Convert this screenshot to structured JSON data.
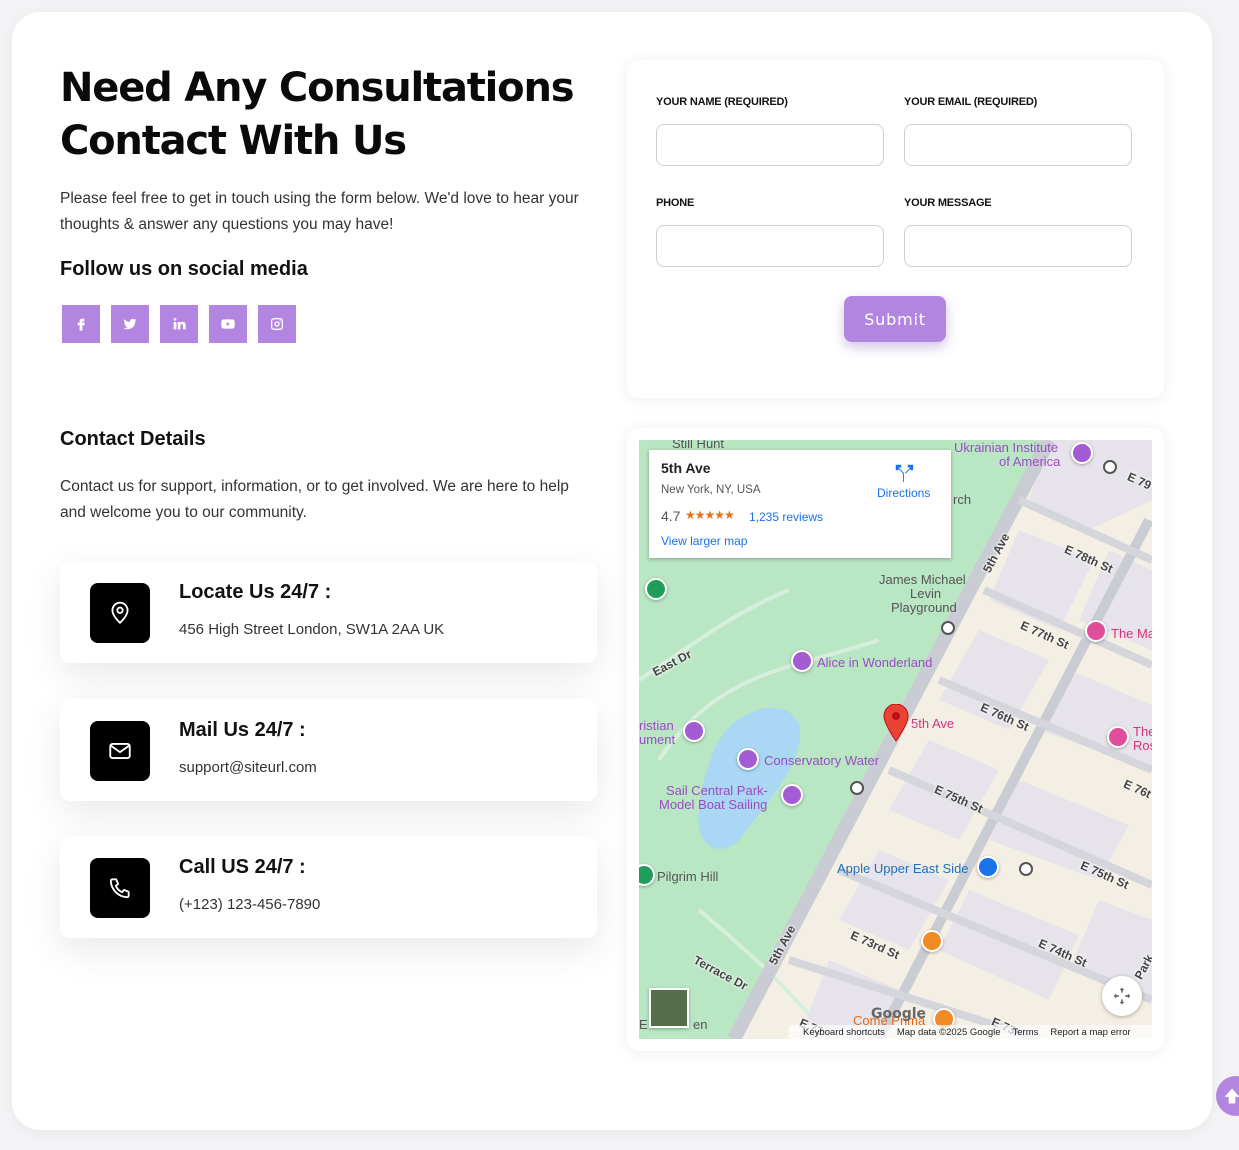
{
  "headline": {
    "line1": "Need Any Consultations",
    "line2": "Contact With Us"
  },
  "intro": "Please feel free to get in touch using the form below. We'd love to hear your thoughts & answer any questions you may have!",
  "follow_title": "Follow us on social media",
  "social": [
    "facebook-icon",
    "twitter-icon",
    "linkedin-icon",
    "youtube-icon",
    "instagram-icon"
  ],
  "contact_details": {
    "title": "Contact Details",
    "text": "Contact us for support, information, or to get involved. We are here to help and welcome you to our community.",
    "cards": [
      {
        "icon": "location-pin-icon",
        "title": "Locate Us 24/7 :",
        "value": "456 High Street London, SW1A 2AA UK"
      },
      {
        "icon": "mail-icon",
        "title": "Mail Us 24/7 :",
        "value": "support@siteurl.com"
      },
      {
        "icon": "phone-icon",
        "title": "Call US 24/7 :",
        "value": "(+123) 123-456-7890"
      }
    ]
  },
  "form": {
    "name_label": "YOUR NAME (REQUIRED)",
    "email_label": "YOUR EMAIL (REQUIRED)",
    "phone_label": "PHONE",
    "message_label": "YOUR MESSAGE",
    "name_value": "",
    "email_value": "",
    "phone_value": "",
    "message_value": "",
    "submit_label": "Submit"
  },
  "map": {
    "place_name": "5th Ave",
    "address": "New York, NY, USA",
    "rating": "4.7",
    "stars": "★★★★★",
    "reviews": "1,235 reviews",
    "larger_map": "View larger map",
    "directions": "Directions",
    "labels": {
      "still_hunt": "Still Hunt",
      "ukrainian": "Ukrainian Institute",
      "of_america": "of America",
      "james": "James Michael",
      "levin": "Levin",
      "playground": "Playground",
      "alice": "Alice in Wonderland",
      "fifth_ave_pin": "5th Ave",
      "christian": "ristian",
      "ument": "ument",
      "conservatory": "Conservatory Water",
      "sail1": "Sail Central Park-",
      "sail2": "Model Boat Sailing",
      "pilgrim": "Pilgrim Hill",
      "apple": "Apple Upper East Side",
      "the_ma": "The Ma",
      "the": "The",
      "ros": "Ros",
      "come_prima": "Come Prima",
      "east_dr": "East Dr",
      "terrace_dr": "Terrace Dr",
      "e79": "E 79",
      "e78": "E 78th St",
      "e77": "E 77th St",
      "e76": "E 76th St",
      "e76b": "E 76t",
      "e75": "E 75th St",
      "e75b": "E 75th St",
      "e74": "E 74th St",
      "e73": "E 73rd St",
      "e72": "E 72",
      "e73b": "E 73r",
      "fifth_ave_a": "5th Ave",
      "fifth_ave_b": "5th Ave",
      "park": "Park",
      "rch": "rch",
      "e_en": "E",
      "en": "en"
    },
    "google": "Google",
    "footer": [
      "Keyboard shortcuts",
      "Map data ©2025 Google",
      "Terms",
      "Report a map error"
    ]
  },
  "colors": {
    "accent": "#b286e0",
    "dark": "#000000"
  }
}
